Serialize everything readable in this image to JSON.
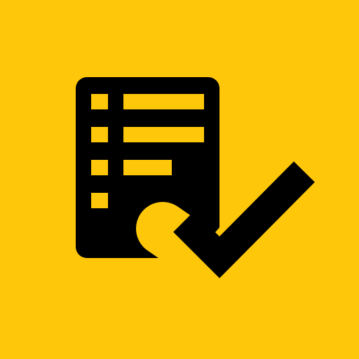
{
  "icon": {
    "name": "checklist-icon",
    "background_color": "#FFC709",
    "foreground_color": "#000000"
  }
}
